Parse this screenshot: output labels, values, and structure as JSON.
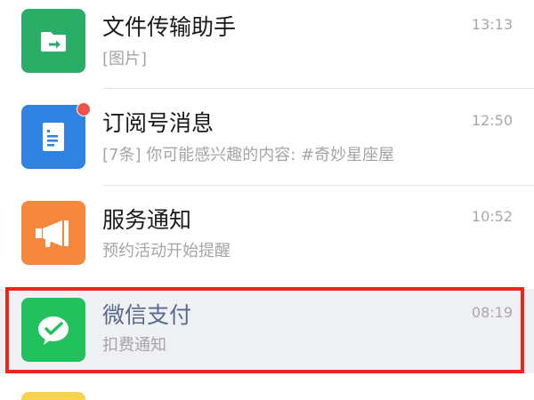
{
  "chats": [
    {
      "title": "文件传输助手",
      "subtitle": "[图片]",
      "time": "13:13",
      "avatar_icon": "folder-transfer-icon",
      "avatar_color": "#2aae67"
    },
    {
      "title": "订阅号消息",
      "subtitle": "[7条] 你可能感兴趣的内容: #奇妙星座屋",
      "time": "12:50",
      "avatar_icon": "document-icon",
      "avatar_color": "#2f82e0",
      "has_unread_dot": true
    },
    {
      "title": "服务通知",
      "subtitle": "预约活动开始提醒",
      "time": "10:52",
      "avatar_icon": "megaphone-icon",
      "avatar_color": "#f5883d"
    },
    {
      "title": "微信支付",
      "subtitle": "扣费通知",
      "time": "08:19",
      "avatar_icon": "wechat-pay-icon",
      "avatar_color": "#22c15e",
      "highlighted": true
    }
  ],
  "colors": {
    "highlight_border": "#e8271d",
    "unread_dot": "#f0514b",
    "partial_avatar": "#f7d24a"
  }
}
